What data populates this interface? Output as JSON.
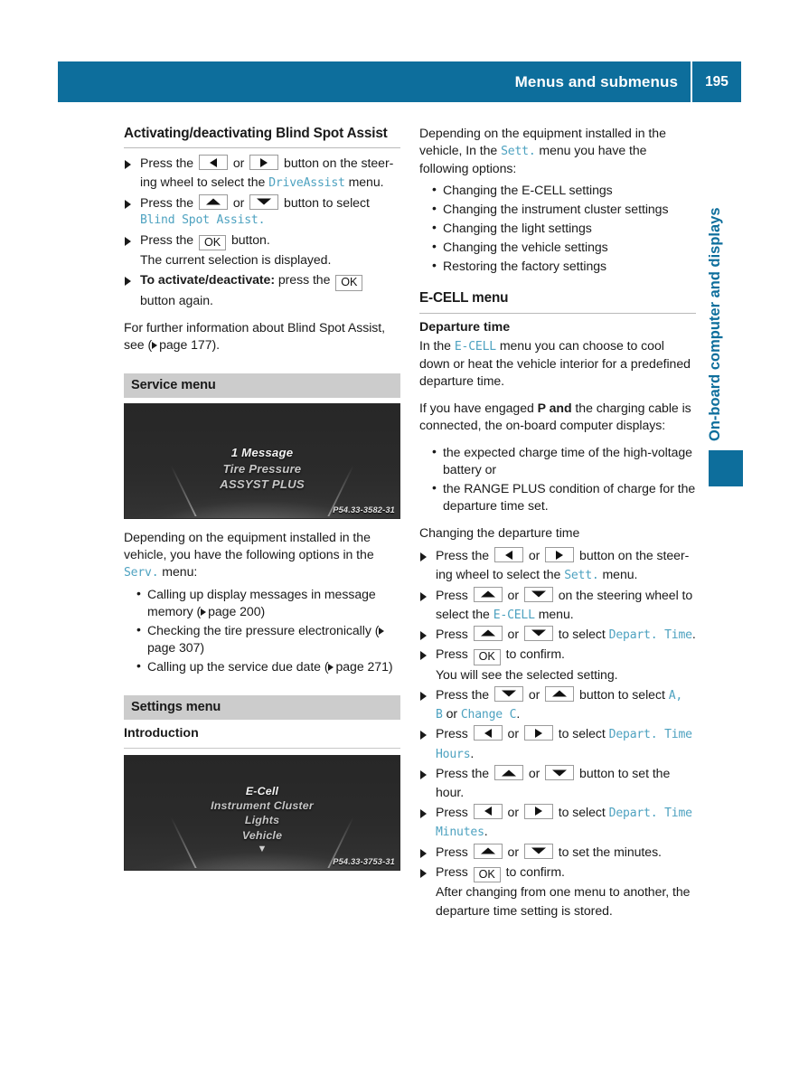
{
  "header": {
    "title": "Menus and submenus",
    "page_number": "195"
  },
  "side_tab": {
    "label": "On-board computer and displays"
  },
  "left_column": {
    "heading": "Activating/deactivating Blind Spot Assist",
    "steps": [
      {
        "prefix": "Press the",
        "keys": [
          "left-arrow",
          "right-arrow"
        ],
        "or": "or",
        "text_after": "button on the steer-ing wheel to select the",
        "mono": "DriveAssist",
        "tail": "menu."
      },
      {
        "prefix": "Press the",
        "keys": [
          "up-arrow",
          "down-arrow"
        ],
        "or": "or",
        "text_after": "button to select",
        "mono": "Blind Spot Assist.",
        "tail": ""
      },
      {
        "prefix": "Press the",
        "keys": [
          "ok"
        ],
        "text_after": "button.",
        "sub_line": "The current selection is displayed."
      },
      {
        "bold_lead": "To activate/deactivate:",
        "prefix": "press the",
        "keys": [
          "ok"
        ],
        "sub_line": "button again."
      }
    ],
    "further_info": "For further information about Blind Spot Assist, see (",
    "further_info_page": "page 177).",
    "service_section": {
      "bar_label": "Service menu",
      "figure": {
        "lines": [
          "1 Message",
          "Tire Pressure",
          "ASSYST PLUS"
        ],
        "selected_index": 0,
        "code": "P54.33-3582-31"
      },
      "intro": "Depending on the equipment installed in the vehicle, you have the following options in the",
      "intro_mono": "Serv.",
      "intro_tail": "menu:",
      "options": [
        {
          "text": "Calling up display messages in message memory (",
          "page": "page 200)"
        },
        {
          "text": "Checking the tire pressure electronically (",
          "page": "page 307)"
        },
        {
          "text": "Calling up the service due date (",
          "page": "page 271)"
        }
      ]
    },
    "settings_section": {
      "bar_label": "Settings menu",
      "sub_heading": "Introduction",
      "figure": {
        "lines": [
          "E-Cell",
          "Instrument Cluster",
          "Lights",
          "Vehicle"
        ],
        "selected_index": 0,
        "caret": "▼",
        "code": "P54.33-3753-31"
      }
    }
  },
  "right_column": {
    "intro": "Depending on the equipment installed in the vehicle, In the",
    "intro_mono": "Sett.",
    "intro_tail": "menu you have the following options:",
    "options": [
      "Changing the E-CELL settings",
      "Changing the instrument cluster settings",
      "Changing the light settings",
      "Changing the vehicle settings",
      "Restoring the factory settings"
    ],
    "ecell_bar_label": "E-CELL menu",
    "departure_heading": "Departure time",
    "departure_p1_a": "In the",
    "departure_p1_mono": "E-CELL",
    "departure_p1_b": "menu you can choose to cool down or heat the vehicle interior for a predefined departure time.",
    "departure_p2_a": "If you have engaged",
    "departure_p2_bold": "P and",
    "departure_p2_b": "the charging cable is connected, the on-board computer displays:",
    "departure_bullets": [
      "the expected charge time of the high-voltage battery or",
      "the RANGE PLUS condition of charge for the departure time set."
    ],
    "changing_heading": "Changing the departure time",
    "changing_steps": [
      {
        "prefix": "Press the",
        "keys": [
          "left-arrow",
          "right-arrow"
        ],
        "text_after": "button on the steer-ing wheel to select the",
        "mono": "Sett.",
        "tail": "menu."
      },
      {
        "prefix": "Press",
        "keys": [
          "up-arrow",
          "down-arrow"
        ],
        "text_after": "on the steering wheel to select the",
        "mono": "E-CELL",
        "tail": "menu."
      },
      {
        "prefix": "Press",
        "keys": [
          "up-arrow",
          "down-arrow"
        ],
        "text_after": "to select",
        "mono": "Depart. Time",
        "tail": "."
      },
      {
        "prefix": "Press",
        "keys": [
          "ok"
        ],
        "text_after": "to confirm.",
        "sub_line": "You will see the selected setting."
      },
      {
        "prefix": "Press the",
        "keys": [
          "down-arrow",
          "up-arrow"
        ],
        "text_after": "button to select",
        "mono": "A, B",
        "tail2": "or",
        "mono2": "Change C",
        "tail": "."
      },
      {
        "prefix": "Press",
        "keys": [
          "left-arrow",
          "right-arrow"
        ],
        "text_after": "to select",
        "mono": "Depart. Time Hours",
        "tail": "."
      },
      {
        "prefix": "Press the",
        "keys": [
          "up-arrow",
          "down-arrow"
        ],
        "text_after": "button to set the hour."
      },
      {
        "prefix": "Press",
        "keys": [
          "left-arrow",
          "right-arrow"
        ],
        "text_after": "to select",
        "mono": "Depart. Time Minutes",
        "tail": "."
      },
      {
        "prefix": "Press",
        "keys": [
          "up-arrow",
          "down-arrow"
        ],
        "text_after": "to set the minutes."
      },
      {
        "prefix": "Press",
        "keys": [
          "ok"
        ],
        "text_after": "to confirm.",
        "sub_line": "After changing from one menu to another, the departure time setting is stored."
      }
    ],
    "word_or": "or"
  },
  "colors": {
    "accent_blue": "#0d6e9c",
    "mono_teal": "#4ea2c0",
    "section_bar_gray": "#cccccc"
  }
}
